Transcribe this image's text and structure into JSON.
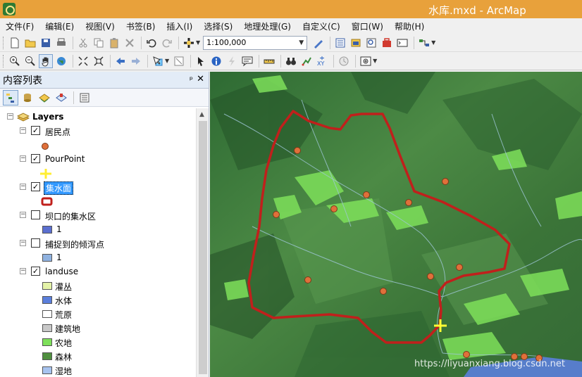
{
  "window": {
    "title": "水库.mxd - ArcMap"
  },
  "menu": [
    "文件(F)",
    "编辑(E)",
    "视图(V)",
    "书签(B)",
    "插入(I)",
    "选择(S)",
    "地理处理(G)",
    "自定义(C)",
    "窗口(W)",
    "帮助(H)"
  ],
  "toolbar": {
    "scale_value": "1:100,000"
  },
  "toc": {
    "title": "内容列表",
    "pin": "ᵖ",
    "close": "✕",
    "root_label": "Layers",
    "layers": [
      {
        "label": "居民点",
        "checked": true,
        "symbol": "point-orange"
      },
      {
        "label": "PourPoint",
        "checked": true,
        "symbol": "cross-yellow"
      },
      {
        "label": "集水面",
        "checked": true,
        "symbol": "polygon-red-outline",
        "selected": true
      },
      {
        "label": "坝口的集水区",
        "checked": false,
        "symbol": "fill-blue",
        "class_label": "1"
      },
      {
        "label": "捕捉到的倾泻点",
        "checked": false,
        "symbol": "fill-lightblue",
        "class_label": "1"
      },
      {
        "label": "landuse",
        "checked": true
      }
    ],
    "landuse_classes": [
      {
        "label": "灌丛",
        "color": "#e4f3a8"
      },
      {
        "label": "水体",
        "color": "#5b7fdc"
      },
      {
        "label": "荒原",
        "color": "#ffffff"
      },
      {
        "label": "建筑地",
        "color": "#c8c8c8"
      },
      {
        "label": "农地",
        "color": "#7ee05a"
      },
      {
        "label": "森林",
        "color": "#4f8f3f"
      },
      {
        "label": "湿地",
        "color": "#a7c3ef"
      }
    ]
  },
  "colors": {
    "title_bar": "#e8a13b",
    "watershed_outline": "#c0201c",
    "settlement_point": "#e0703a",
    "pour_point": "#ffff33"
  },
  "watermark": "https://liyuanxiang.blog.csdn.net"
}
